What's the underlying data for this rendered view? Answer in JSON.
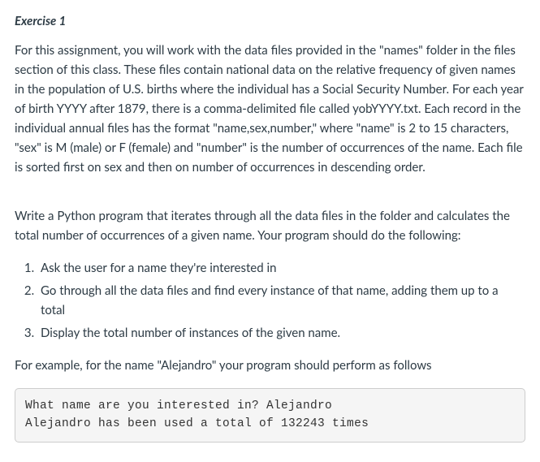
{
  "heading": "Exercise 1",
  "intro": "For this assignment, you will work with the data files provided in the \"names\" folder in the files section of this class. These files contain national data on the relative frequency of given names in the population of U.S. births where the individual has a Social Security Number. For each year of birth YYYY after 1879, there is a comma-delimited file called yobYYYY.txt. Each record in the individual annual files has the format \"name,sex,number,\" where \"name\" is 2 to 15 characters, \"sex\" is M (male) or F (female) and \"number\" is the number of occurrences of the name. Each file is sorted first on sex and then on number of occurrences in descending order.",
  "task": "Write a Python program that iterates through all the data files in the folder and calculates the total number of occurrences of a given name. Your program should do the following:",
  "steps": [
    "Ask the user for a name they're interested in",
    "Go through all the data files and find every instance of that name, adding them up to a total",
    "Display the total number of instances of the given name."
  ],
  "example_intro": "For example, for the name \"Alejandro\" your program should perform as follows",
  "code_output": "What name are you interested in? Alejandro\nAlejandro has been used a total of 132243 times"
}
